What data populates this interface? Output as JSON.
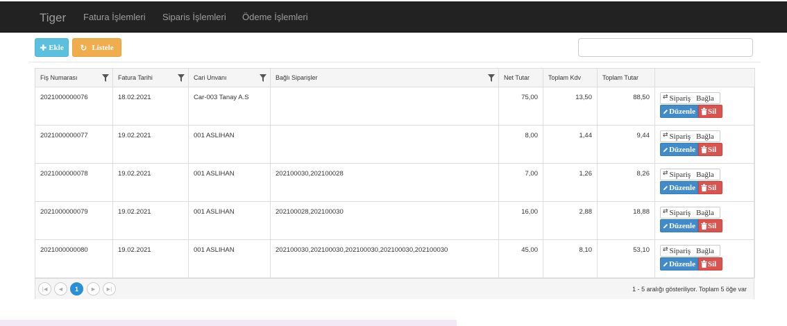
{
  "navbar": {
    "brand": "Tiger",
    "items": [
      {
        "label": "Fatura İşlemleri"
      },
      {
        "label": "Siparis İşlemleri"
      },
      {
        "label": "Ödeme İşlemleri"
      }
    ]
  },
  "toolbar": {
    "add_label": "Ekle",
    "add_icon": "plus-icon",
    "list_label": "Listele",
    "list_icon": "refresh-icon",
    "search_value": "",
    "search_placeholder": ""
  },
  "table": {
    "columns": [
      {
        "label": "Fiş Numarası",
        "filter": true
      },
      {
        "label": "Fatura Tarihi",
        "filter": true
      },
      {
        "label": "Cari Unvanı",
        "filter": true
      },
      {
        "label": "Bağlı Siparişler",
        "filter": true
      },
      {
        "label": "Net Tutar",
        "filter": false
      },
      {
        "label": "Toplam Kdv",
        "filter": false
      },
      {
        "label": "Toplam Tutar",
        "filter": false
      },
      {
        "label": "",
        "filter": false
      }
    ],
    "rows": [
      {
        "fis_no": "2021000000076",
        "tarih": "18.02.2021",
        "cari": "Car-003 Tanay A.S",
        "siparisler": "",
        "net": "75,00",
        "kdv": "13,50",
        "toplam": "88,50"
      },
      {
        "fis_no": "2021000000077",
        "tarih": "19.02.2021",
        "cari": "001 ASLIHAN",
        "siparisler": "",
        "net": "8,00",
        "kdv": "1,44",
        "toplam": "9,44"
      },
      {
        "fis_no": "2021000000078",
        "tarih": "19.02.2021",
        "cari": "001 ASLIHAN",
        "siparisler": "202100030,202100028",
        "net": "7,00",
        "kdv": "1,26",
        "toplam": "8,26"
      },
      {
        "fis_no": "2021000000079",
        "tarih": "19.02.2021",
        "cari": "001 ASLIHAN",
        "siparisler": "202100028,202100030",
        "net": "16,00",
        "kdv": "2,88",
        "toplam": "18,88"
      },
      {
        "fis_no": "2021000000080",
        "tarih": "19.02.2021",
        "cari": "001 ASLIHAN",
        "siparisler": "202100030,202100030,202100030,202100030,202100030",
        "net": "45,00",
        "kdv": "8,10",
        "toplam": "53,10"
      }
    ],
    "row_actions": {
      "siparis_word1": "Sipariş",
      "siparis_word2": "Bağla",
      "siparis_icon": "swap-arrows-icon",
      "duzenle_label": "Düzenle",
      "duzenle_icon": "pencil-icon",
      "sil_label": "Sil",
      "sil_icon": "trash-icon"
    }
  },
  "pager": {
    "first_icon": "first-page-icon",
    "prev_icon": "prev-page-icon",
    "current_page": "1",
    "next_icon": "next-page-icon",
    "last_icon": "last-page-icon",
    "info": "1 - 5 aralığı gösteriliyor. Toplam 5 öğe var"
  },
  "colors": {
    "navbar_bg": "#222222",
    "add_button": "#5bc0de",
    "list_button": "#f0ad4e",
    "edit_button": "#428bca",
    "delete_button": "#d9534f",
    "active_page": "#2a8fd6"
  }
}
